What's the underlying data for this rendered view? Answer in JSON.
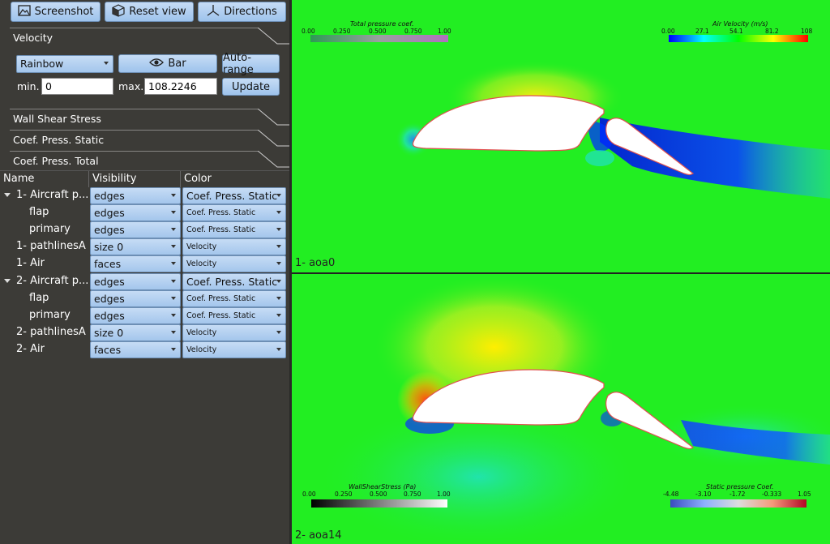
{
  "toolbar": {
    "screenshot_label": "Screenshot",
    "reset_view_label": "Reset view",
    "directions_label": "Directions"
  },
  "sections": {
    "velocity": "Velocity",
    "wall_shear_stress": "Wall Shear Stress",
    "coef_press_static": "Coef. Press. Static",
    "coef_press_total": "Coef. Press. Total"
  },
  "colormap": {
    "selected": "Rainbow",
    "bar_label": "Bar",
    "auto_range_label": "Auto-range",
    "min_label": "min.",
    "min_value": "0",
    "max_label": "max.",
    "max_value": "108.2246",
    "update_label": "Update"
  },
  "table": {
    "headers": {
      "name": "Name",
      "visibility": "Visibility",
      "color": "Color"
    },
    "rows": [
      {
        "name": "1- Aircraft p...",
        "visibility": "edges",
        "color": "Coef. Press. Static",
        "expandable": true
      },
      {
        "name": "flap",
        "visibility": "edges",
        "color": "Coef. Press. Static"
      },
      {
        "name": "primary",
        "visibility": "edges",
        "color": "Coef. Press. Static"
      },
      {
        "name": "1- pathlinesA",
        "visibility": "size 0",
        "color": "Velocity"
      },
      {
        "name": "1- Air",
        "visibility": "faces",
        "color": "Velocity"
      },
      {
        "name": "2- Aircraft p...",
        "visibility": "edges",
        "color": "Coef. Press. Static",
        "expandable": true
      },
      {
        "name": "flap",
        "visibility": "edges",
        "color": "Coef. Press. Static"
      },
      {
        "name": "primary",
        "visibility": "edges",
        "color": "Coef. Press. Static"
      },
      {
        "name": "2- pathlinesA",
        "visibility": "size 0",
        "color": "Velocity"
      },
      {
        "name": "2- Air",
        "visibility": "faces",
        "color": "Velocity"
      }
    ]
  },
  "viewport1": {
    "label": "1- aoa0",
    "legend_total_pressure": {
      "title": "Total pressure coef.",
      "ticks": [
        "0.00",
        "0.250",
        "0.500",
        "0.750",
        "1.00"
      ]
    },
    "legend_air_velocity": {
      "title": "Air Velocity (m/s)",
      "ticks": [
        "0.00",
        "27.1",
        "54.1",
        "81.2",
        "108"
      ]
    }
  },
  "viewport2": {
    "label": "2- aoa14",
    "legend_wall_shear": {
      "title": "WallShearStress (Pa)",
      "ticks": [
        "0.00",
        "0.250",
        "0.500",
        "0.750",
        "1.00"
      ]
    },
    "legend_static_pressure": {
      "title": "Static pressure Coef.",
      "ticks": [
        "-4.48",
        "-3.10",
        "-1.72",
        "-0.333",
        "1.05"
      ]
    }
  },
  "colors": {
    "panel_bg": "#3c3b37",
    "button_blue": "#a9cbf0",
    "field_green": "#22ee22"
  }
}
